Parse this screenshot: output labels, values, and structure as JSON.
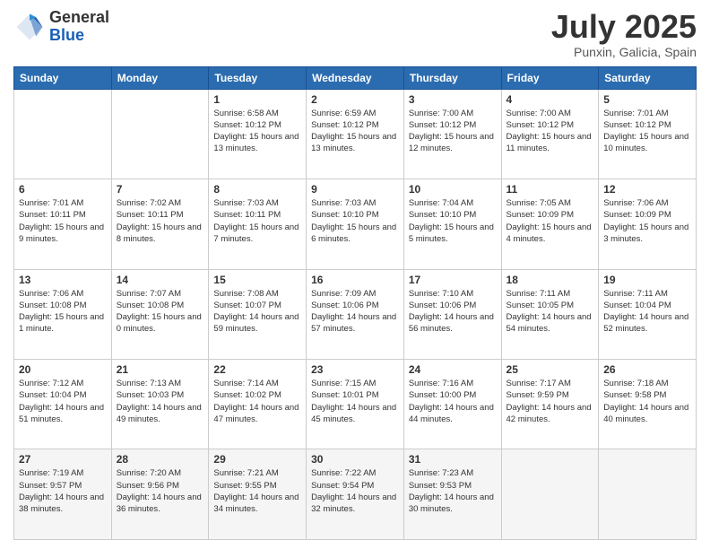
{
  "logo": {
    "general": "General",
    "blue": "Blue"
  },
  "title": "July 2025",
  "location": "Punxin, Galicia, Spain",
  "days_of_week": [
    "Sunday",
    "Monday",
    "Tuesday",
    "Wednesday",
    "Thursday",
    "Friday",
    "Saturday"
  ],
  "weeks": [
    [
      {
        "day": "",
        "info": ""
      },
      {
        "day": "",
        "info": ""
      },
      {
        "day": "1",
        "info": "Sunrise: 6:58 AM\nSunset: 10:12 PM\nDaylight: 15 hours\nand 13 minutes."
      },
      {
        "day": "2",
        "info": "Sunrise: 6:59 AM\nSunset: 10:12 PM\nDaylight: 15 hours\nand 13 minutes."
      },
      {
        "day": "3",
        "info": "Sunrise: 7:00 AM\nSunset: 10:12 PM\nDaylight: 15 hours\nand 12 minutes."
      },
      {
        "day": "4",
        "info": "Sunrise: 7:00 AM\nSunset: 10:12 PM\nDaylight: 15 hours\nand 11 minutes."
      },
      {
        "day": "5",
        "info": "Sunrise: 7:01 AM\nSunset: 10:12 PM\nDaylight: 15 hours\nand 10 minutes."
      }
    ],
    [
      {
        "day": "6",
        "info": "Sunrise: 7:01 AM\nSunset: 10:11 PM\nDaylight: 15 hours\nand 9 minutes."
      },
      {
        "day": "7",
        "info": "Sunrise: 7:02 AM\nSunset: 10:11 PM\nDaylight: 15 hours\nand 8 minutes."
      },
      {
        "day": "8",
        "info": "Sunrise: 7:03 AM\nSunset: 10:11 PM\nDaylight: 15 hours\nand 7 minutes."
      },
      {
        "day": "9",
        "info": "Sunrise: 7:03 AM\nSunset: 10:10 PM\nDaylight: 15 hours\nand 6 minutes."
      },
      {
        "day": "10",
        "info": "Sunrise: 7:04 AM\nSunset: 10:10 PM\nDaylight: 15 hours\nand 5 minutes."
      },
      {
        "day": "11",
        "info": "Sunrise: 7:05 AM\nSunset: 10:09 PM\nDaylight: 15 hours\nand 4 minutes."
      },
      {
        "day": "12",
        "info": "Sunrise: 7:06 AM\nSunset: 10:09 PM\nDaylight: 15 hours\nand 3 minutes."
      }
    ],
    [
      {
        "day": "13",
        "info": "Sunrise: 7:06 AM\nSunset: 10:08 PM\nDaylight: 15 hours\nand 1 minute."
      },
      {
        "day": "14",
        "info": "Sunrise: 7:07 AM\nSunset: 10:08 PM\nDaylight: 15 hours\nand 0 minutes."
      },
      {
        "day": "15",
        "info": "Sunrise: 7:08 AM\nSunset: 10:07 PM\nDaylight: 14 hours\nand 59 minutes."
      },
      {
        "day": "16",
        "info": "Sunrise: 7:09 AM\nSunset: 10:06 PM\nDaylight: 14 hours\nand 57 minutes."
      },
      {
        "day": "17",
        "info": "Sunrise: 7:10 AM\nSunset: 10:06 PM\nDaylight: 14 hours\nand 56 minutes."
      },
      {
        "day": "18",
        "info": "Sunrise: 7:11 AM\nSunset: 10:05 PM\nDaylight: 14 hours\nand 54 minutes."
      },
      {
        "day": "19",
        "info": "Sunrise: 7:11 AM\nSunset: 10:04 PM\nDaylight: 14 hours\nand 52 minutes."
      }
    ],
    [
      {
        "day": "20",
        "info": "Sunrise: 7:12 AM\nSunset: 10:04 PM\nDaylight: 14 hours\nand 51 minutes."
      },
      {
        "day": "21",
        "info": "Sunrise: 7:13 AM\nSunset: 10:03 PM\nDaylight: 14 hours\nand 49 minutes."
      },
      {
        "day": "22",
        "info": "Sunrise: 7:14 AM\nSunset: 10:02 PM\nDaylight: 14 hours\nand 47 minutes."
      },
      {
        "day": "23",
        "info": "Sunrise: 7:15 AM\nSunset: 10:01 PM\nDaylight: 14 hours\nand 45 minutes."
      },
      {
        "day": "24",
        "info": "Sunrise: 7:16 AM\nSunset: 10:00 PM\nDaylight: 14 hours\nand 44 minutes."
      },
      {
        "day": "25",
        "info": "Sunrise: 7:17 AM\nSunset: 9:59 PM\nDaylight: 14 hours\nand 42 minutes."
      },
      {
        "day": "26",
        "info": "Sunrise: 7:18 AM\nSunset: 9:58 PM\nDaylight: 14 hours\nand 40 minutes."
      }
    ],
    [
      {
        "day": "27",
        "info": "Sunrise: 7:19 AM\nSunset: 9:57 PM\nDaylight: 14 hours\nand 38 minutes."
      },
      {
        "day": "28",
        "info": "Sunrise: 7:20 AM\nSunset: 9:56 PM\nDaylight: 14 hours\nand 36 minutes."
      },
      {
        "day": "29",
        "info": "Sunrise: 7:21 AM\nSunset: 9:55 PM\nDaylight: 14 hours\nand 34 minutes."
      },
      {
        "day": "30",
        "info": "Sunrise: 7:22 AM\nSunset: 9:54 PM\nDaylight: 14 hours\nand 32 minutes."
      },
      {
        "day": "31",
        "info": "Sunrise: 7:23 AM\nSunset: 9:53 PM\nDaylight: 14 hours\nand 30 minutes."
      },
      {
        "day": "",
        "info": ""
      },
      {
        "day": "",
        "info": ""
      }
    ]
  ]
}
